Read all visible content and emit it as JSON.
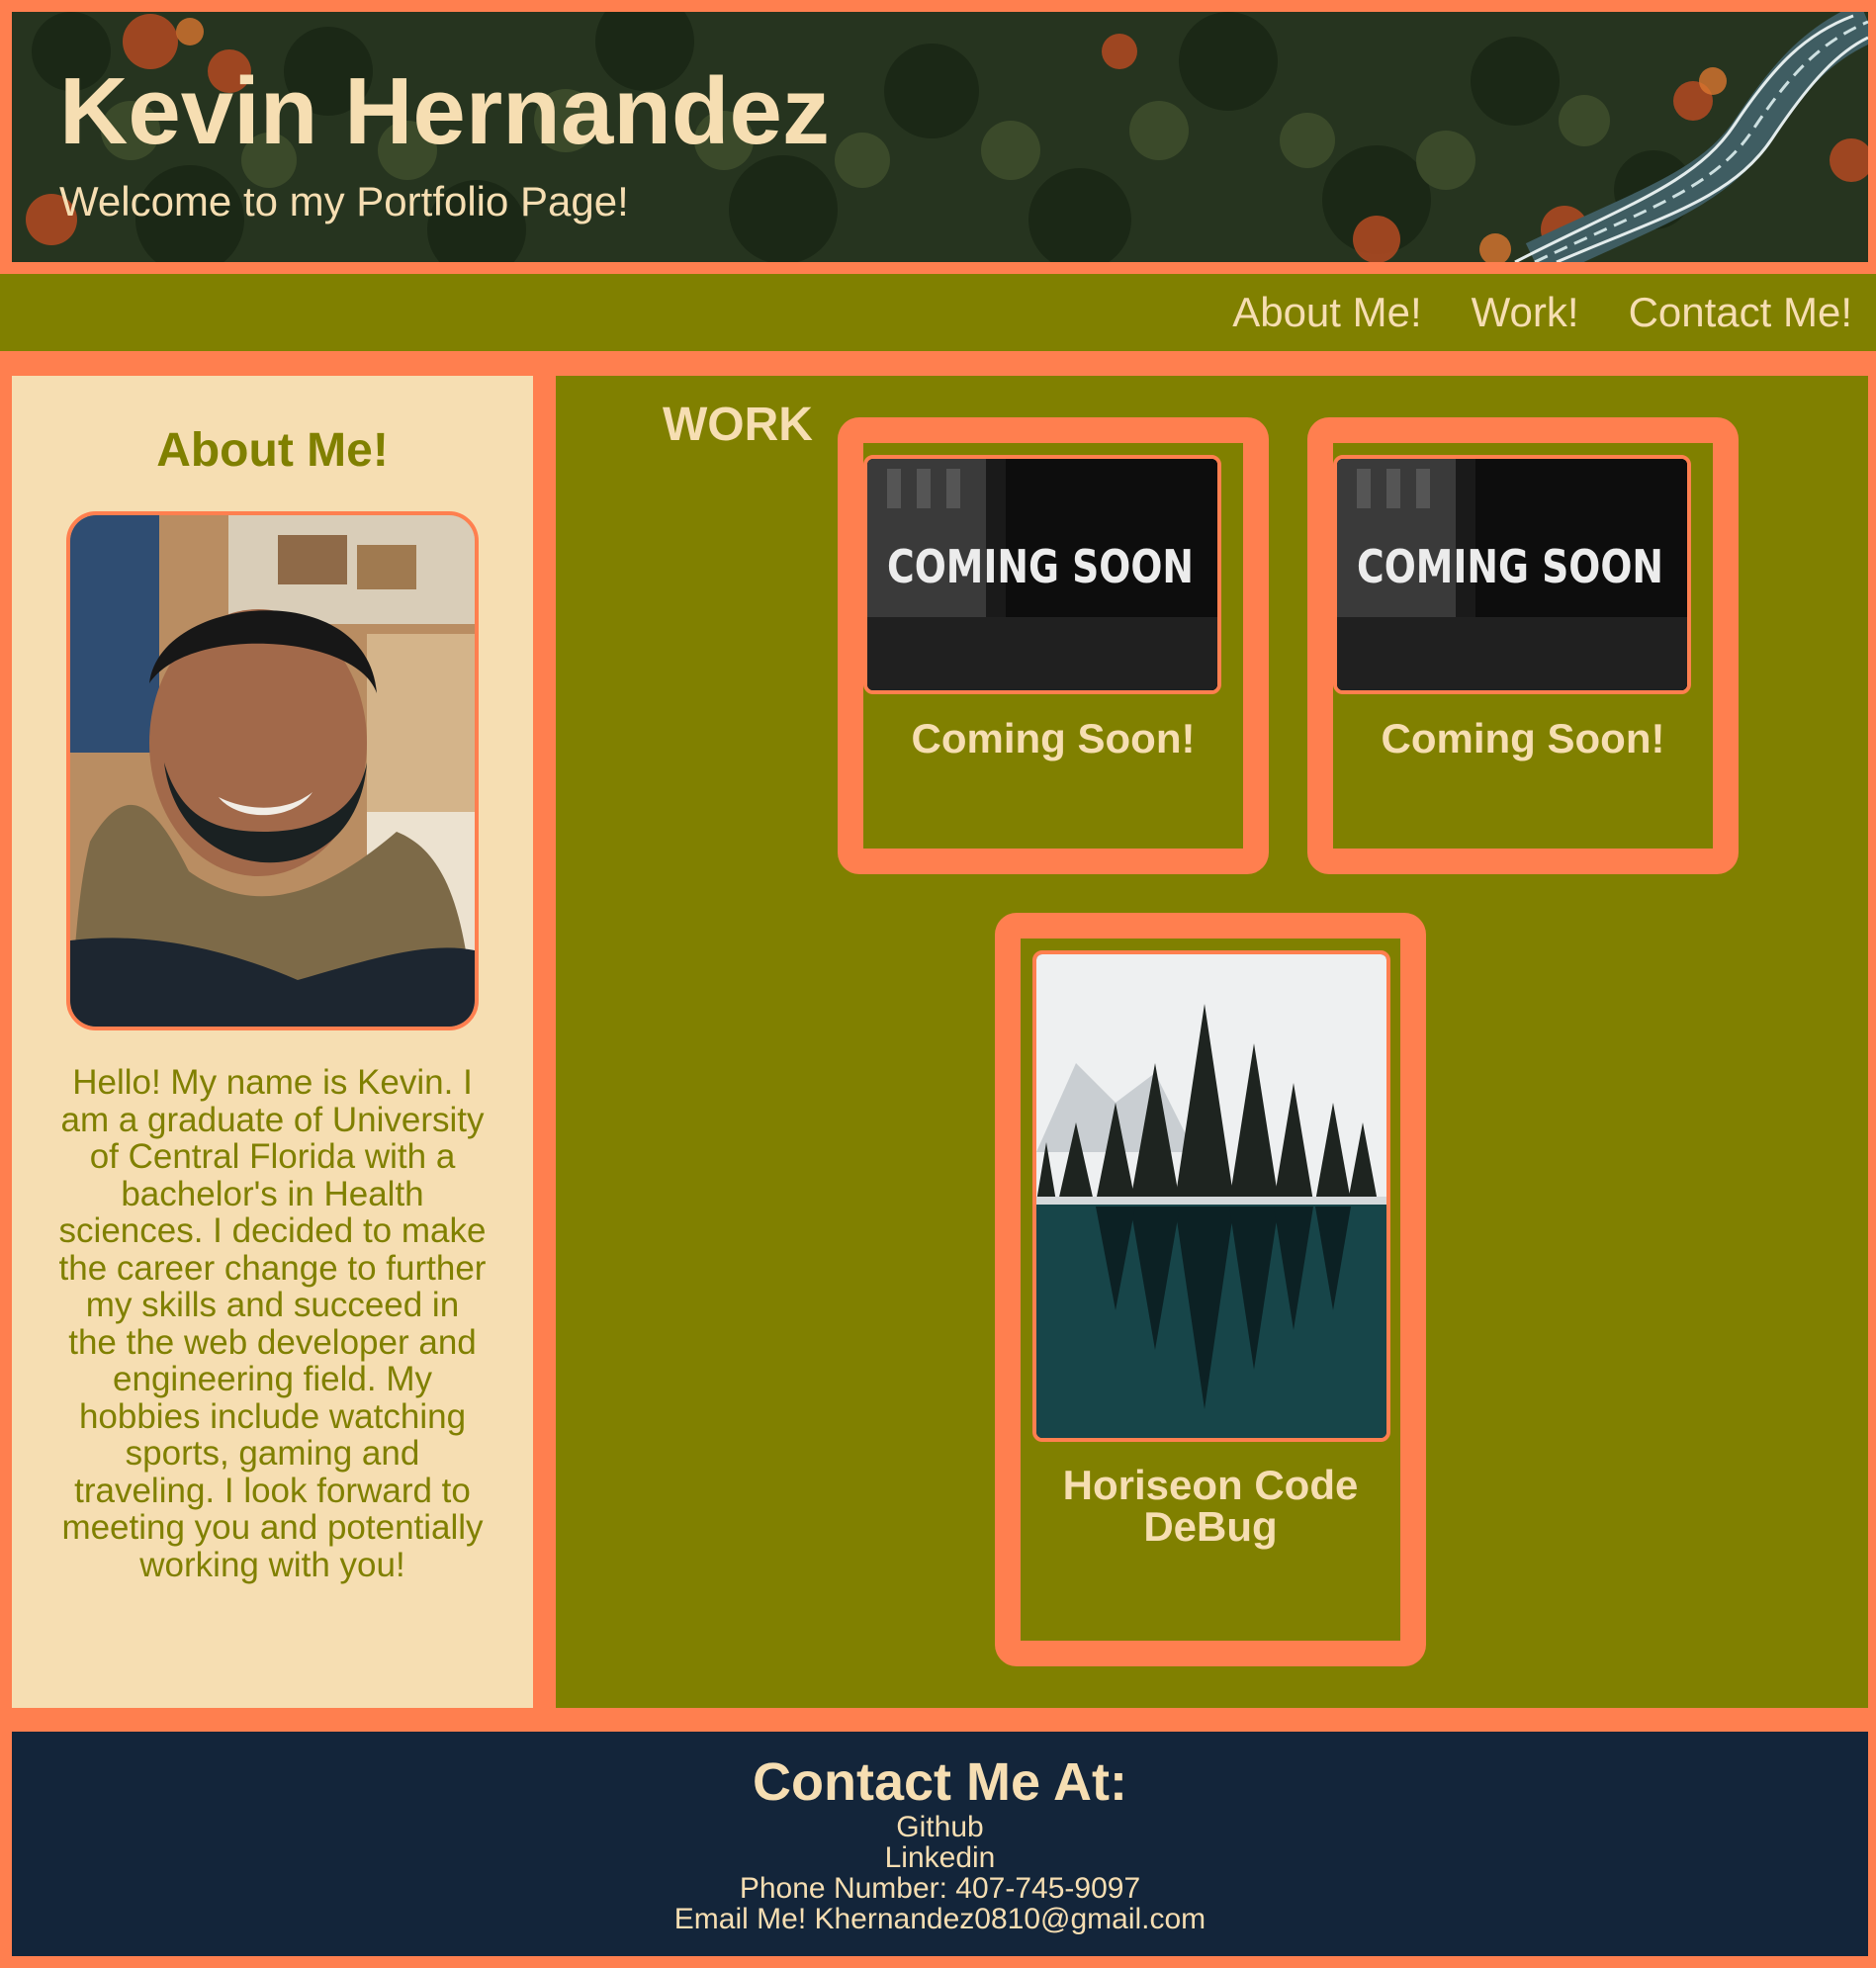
{
  "header": {
    "title": "Kevin Hernandez",
    "subtitle": "Welcome to my Portfolio Page!"
  },
  "nav": {
    "items": [
      {
        "label": "About Me!"
      },
      {
        "label": "Work!"
      },
      {
        "label": "Contact Me!"
      }
    ]
  },
  "about": {
    "title": "About Me!",
    "text": "Hello! My name is Kevin. I am a graduate of University of Central Florida with a bachelor's in Health sciences. I decided to make the career change to further my skills and succeed in the the web developer and engineering field. My hobbies include watching sports, gaming and traveling. I look forward to meeting you and potentially working with you!",
    "photo_text": "Kevin Hernandez"
  },
  "work": {
    "title": "WORK",
    "projects": [
      {
        "label": "Coming Soon!",
        "image_text": "COMING SOON"
      },
      {
        "label": "Coming Soon!",
        "image_text": "COMING SOON"
      },
      {
        "label": "Horiseon Code DeBug",
        "image_text": ""
      }
    ]
  },
  "footer": {
    "title": "Contact Me At:",
    "github": "Github",
    "linkedin": "Linkedin",
    "phone": "Phone Number: 407-745-9097",
    "email": "Email Me! Khernandez0810@gmail.com"
  },
  "colors": {
    "accent": "#ff7f4f",
    "olive": "#808000",
    "wheat": "#f6deb2",
    "navy": "#13253a"
  }
}
